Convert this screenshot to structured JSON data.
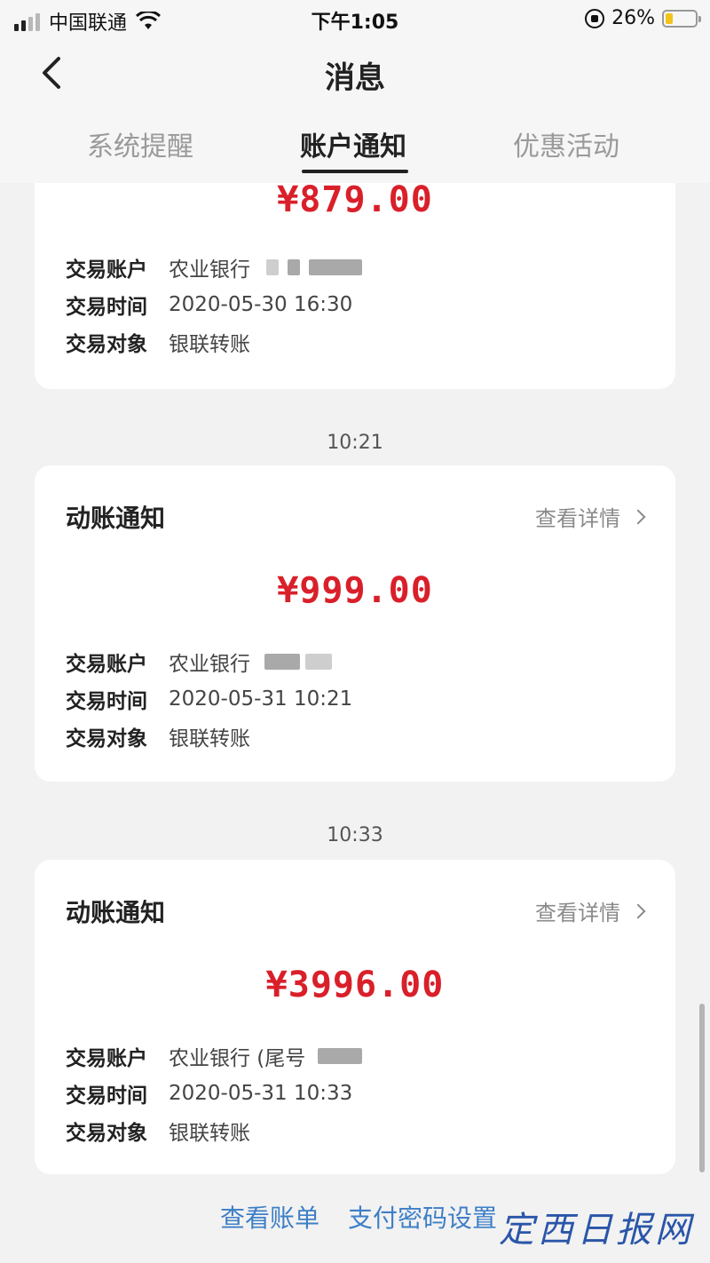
{
  "status_bar": {
    "carrier": "中国联通",
    "time": "下午1:05",
    "battery": "26%",
    "battery_level": 0.26
  },
  "header": {
    "title": "消息"
  },
  "tabs": [
    {
      "label": "系统提醒",
      "active": false
    },
    {
      "label": "账户通知",
      "active": true
    },
    {
      "label": "优惠活动",
      "active": false
    }
  ],
  "cards": [
    {
      "amount": "¥879.00",
      "account_label": "交易账户",
      "account_value": "农业银行",
      "time_label": "交易时间",
      "time_value": "2020-05-30 16:30",
      "party_label": "交易对象",
      "party_value": "银联转账"
    },
    {
      "timestamp": "10:21",
      "title": "动账通知",
      "detail_link": "查看详情",
      "amount": "¥999.00",
      "account_label": "交易账户",
      "account_value": "农业银行",
      "time_label": "交易时间",
      "time_value": "2020-05-31 10:21",
      "party_label": "交易对象",
      "party_value": "银联转账"
    },
    {
      "timestamp": "10:33",
      "title": "动账通知",
      "detail_link": "查看详情",
      "amount": "¥3996.00",
      "account_label": "交易账户",
      "account_value": "农业银行 (尾号",
      "time_label": "交易时间",
      "time_value": "2020-05-31 10:33",
      "party_label": "交易对象",
      "party_value": "银联转账"
    }
  ],
  "bottom_links": {
    "bill": "查看账单",
    "pay_password": "支付密码设置"
  },
  "watermark": "定西日报网",
  "colors": {
    "amount": "#d9202a",
    "link": "#3e7fc7",
    "background": "#f2f2f2"
  }
}
